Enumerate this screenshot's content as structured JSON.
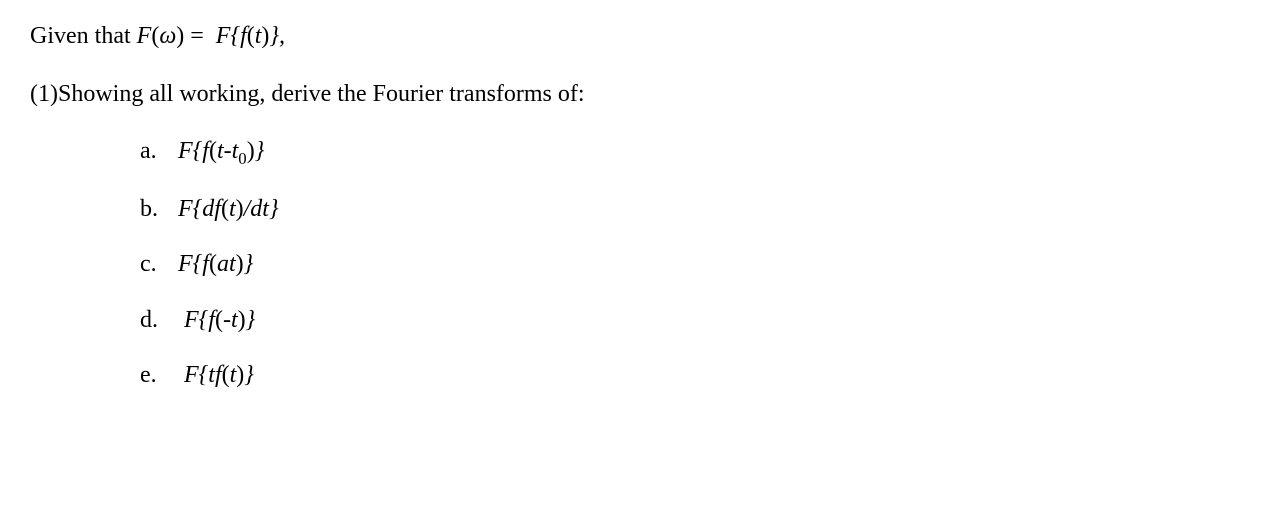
{
  "given": {
    "prefix": "Given that ",
    "lhs_F": "F",
    "lhs_open": "(",
    "lhs_omega": "ω",
    "lhs_close": ") = ",
    "rhs_scriptF": "F",
    "rhs_open": "{",
    "rhs_f": "f",
    "rhs_open2": "(",
    "rhs_t": "t",
    "rhs_close2": ")",
    "rhs_close": "},"
  },
  "prompt": {
    "num": "(1)",
    "text": "Showing all working, derive the Fourier transforms of:"
  },
  "items": [
    {
      "marker": "a.",
      "scriptF": "F",
      "open": "{",
      "f": "f",
      "open2": "(",
      "arg1": "t",
      "minus": "-",
      "arg2": "t",
      "sub": "0",
      "close2": ")",
      "close": "}"
    },
    {
      "marker": "b.",
      "scriptF": "F",
      "open": "{",
      "d1": "d",
      "f": "f",
      "open2": "(",
      "t": "t",
      "close2": ")",
      "slash": "/",
      "d2": "d",
      "t2": "t",
      "close": "}"
    },
    {
      "marker": "c.",
      "scriptF": "F",
      "open": "{",
      "f": "f",
      "open2": "(",
      "a": "a",
      "t": "t",
      "close2": ")",
      "close": "}"
    },
    {
      "marker": "d.",
      "scriptF": "F",
      "open": "{",
      "f": "f",
      "open2": "(",
      "neg": "-",
      "t": "t",
      "close2": ")",
      "close": "}"
    },
    {
      "marker": "e.",
      "scriptF": "F",
      "open": "{",
      "t1": "t",
      "f": "f",
      "open2": "(",
      "t2": "t",
      "close2": ")",
      "close": "}"
    }
  ]
}
